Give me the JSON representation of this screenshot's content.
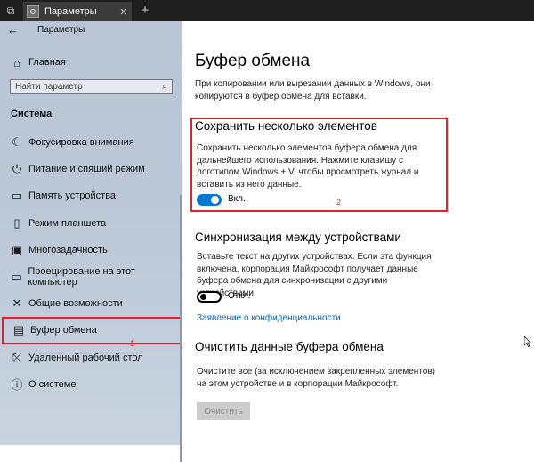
{
  "window": {
    "tab_title": "Параметры",
    "close_glyph": "✕",
    "new_tab_glyph": "+",
    "win_glyph": "⧉"
  },
  "sidebar": {
    "back_glyph": "←",
    "app_title": "Параметры",
    "home_label": "Главная",
    "home_icon": "⌂",
    "search_placeholder": "Найти параметр",
    "search_icon": "⌕",
    "section_title": "Система",
    "items": [
      {
        "label": "Фокусировка внимания",
        "icon": "☾"
      },
      {
        "label": "Питание и спящий режим",
        "icon": "⏻"
      },
      {
        "label": "Память устройства",
        "icon": "▭"
      },
      {
        "label": "Режим планшета",
        "icon": "▯"
      },
      {
        "label": "Многозадачность",
        "icon": "▣"
      },
      {
        "label": "Проецирование на этот компьютер",
        "icon": "▭"
      },
      {
        "label": "Общие возможности",
        "icon": "✕"
      },
      {
        "label": "Буфер обмена",
        "icon": "▤"
      },
      {
        "label": "Удаленный рабочий стол",
        "icon": "⤪"
      },
      {
        "label": "О системе",
        "icon": "ⓘ"
      }
    ],
    "selected_index": 7,
    "annotation_1": "1"
  },
  "main": {
    "title": "Буфер обмена",
    "intro": "При копировании или вырезании данных в Windows, они копируются в буфер обмена для вставки.",
    "history": {
      "heading": "Сохранить несколько элементов",
      "text": "Сохранить несколько элементов буфера обмена для дальнейшего использования. Нажмите клавишу с логотипом Windows + V, чтобы просмотреть журнал и вставить из него данные.",
      "toggle_label": "Вкл.",
      "toggle_on": true,
      "annotation_2": "2"
    },
    "sync": {
      "heading": "Синхронизация между устройствами",
      "text": "Вставьте текст на других устройствах. Если эта функция включена, корпорация Майкрософт получает данные буфера обмена для синхронизации с другими устройствами.",
      "toggle_label": "Откл.",
      "toggle_on": false
    },
    "privacy_link": "Заявление о конфиденциальности",
    "clear": {
      "heading": "Очистить данные буфера обмена",
      "text": "Очистите все (за исключением закрепленных элементов) на этом устройстве и в корпорации Майкрософт.",
      "button_label": "Очистить"
    }
  },
  "colors": {
    "accent": "#0078d7",
    "annotation_red": "#e0232b",
    "link": "#0067b8"
  }
}
